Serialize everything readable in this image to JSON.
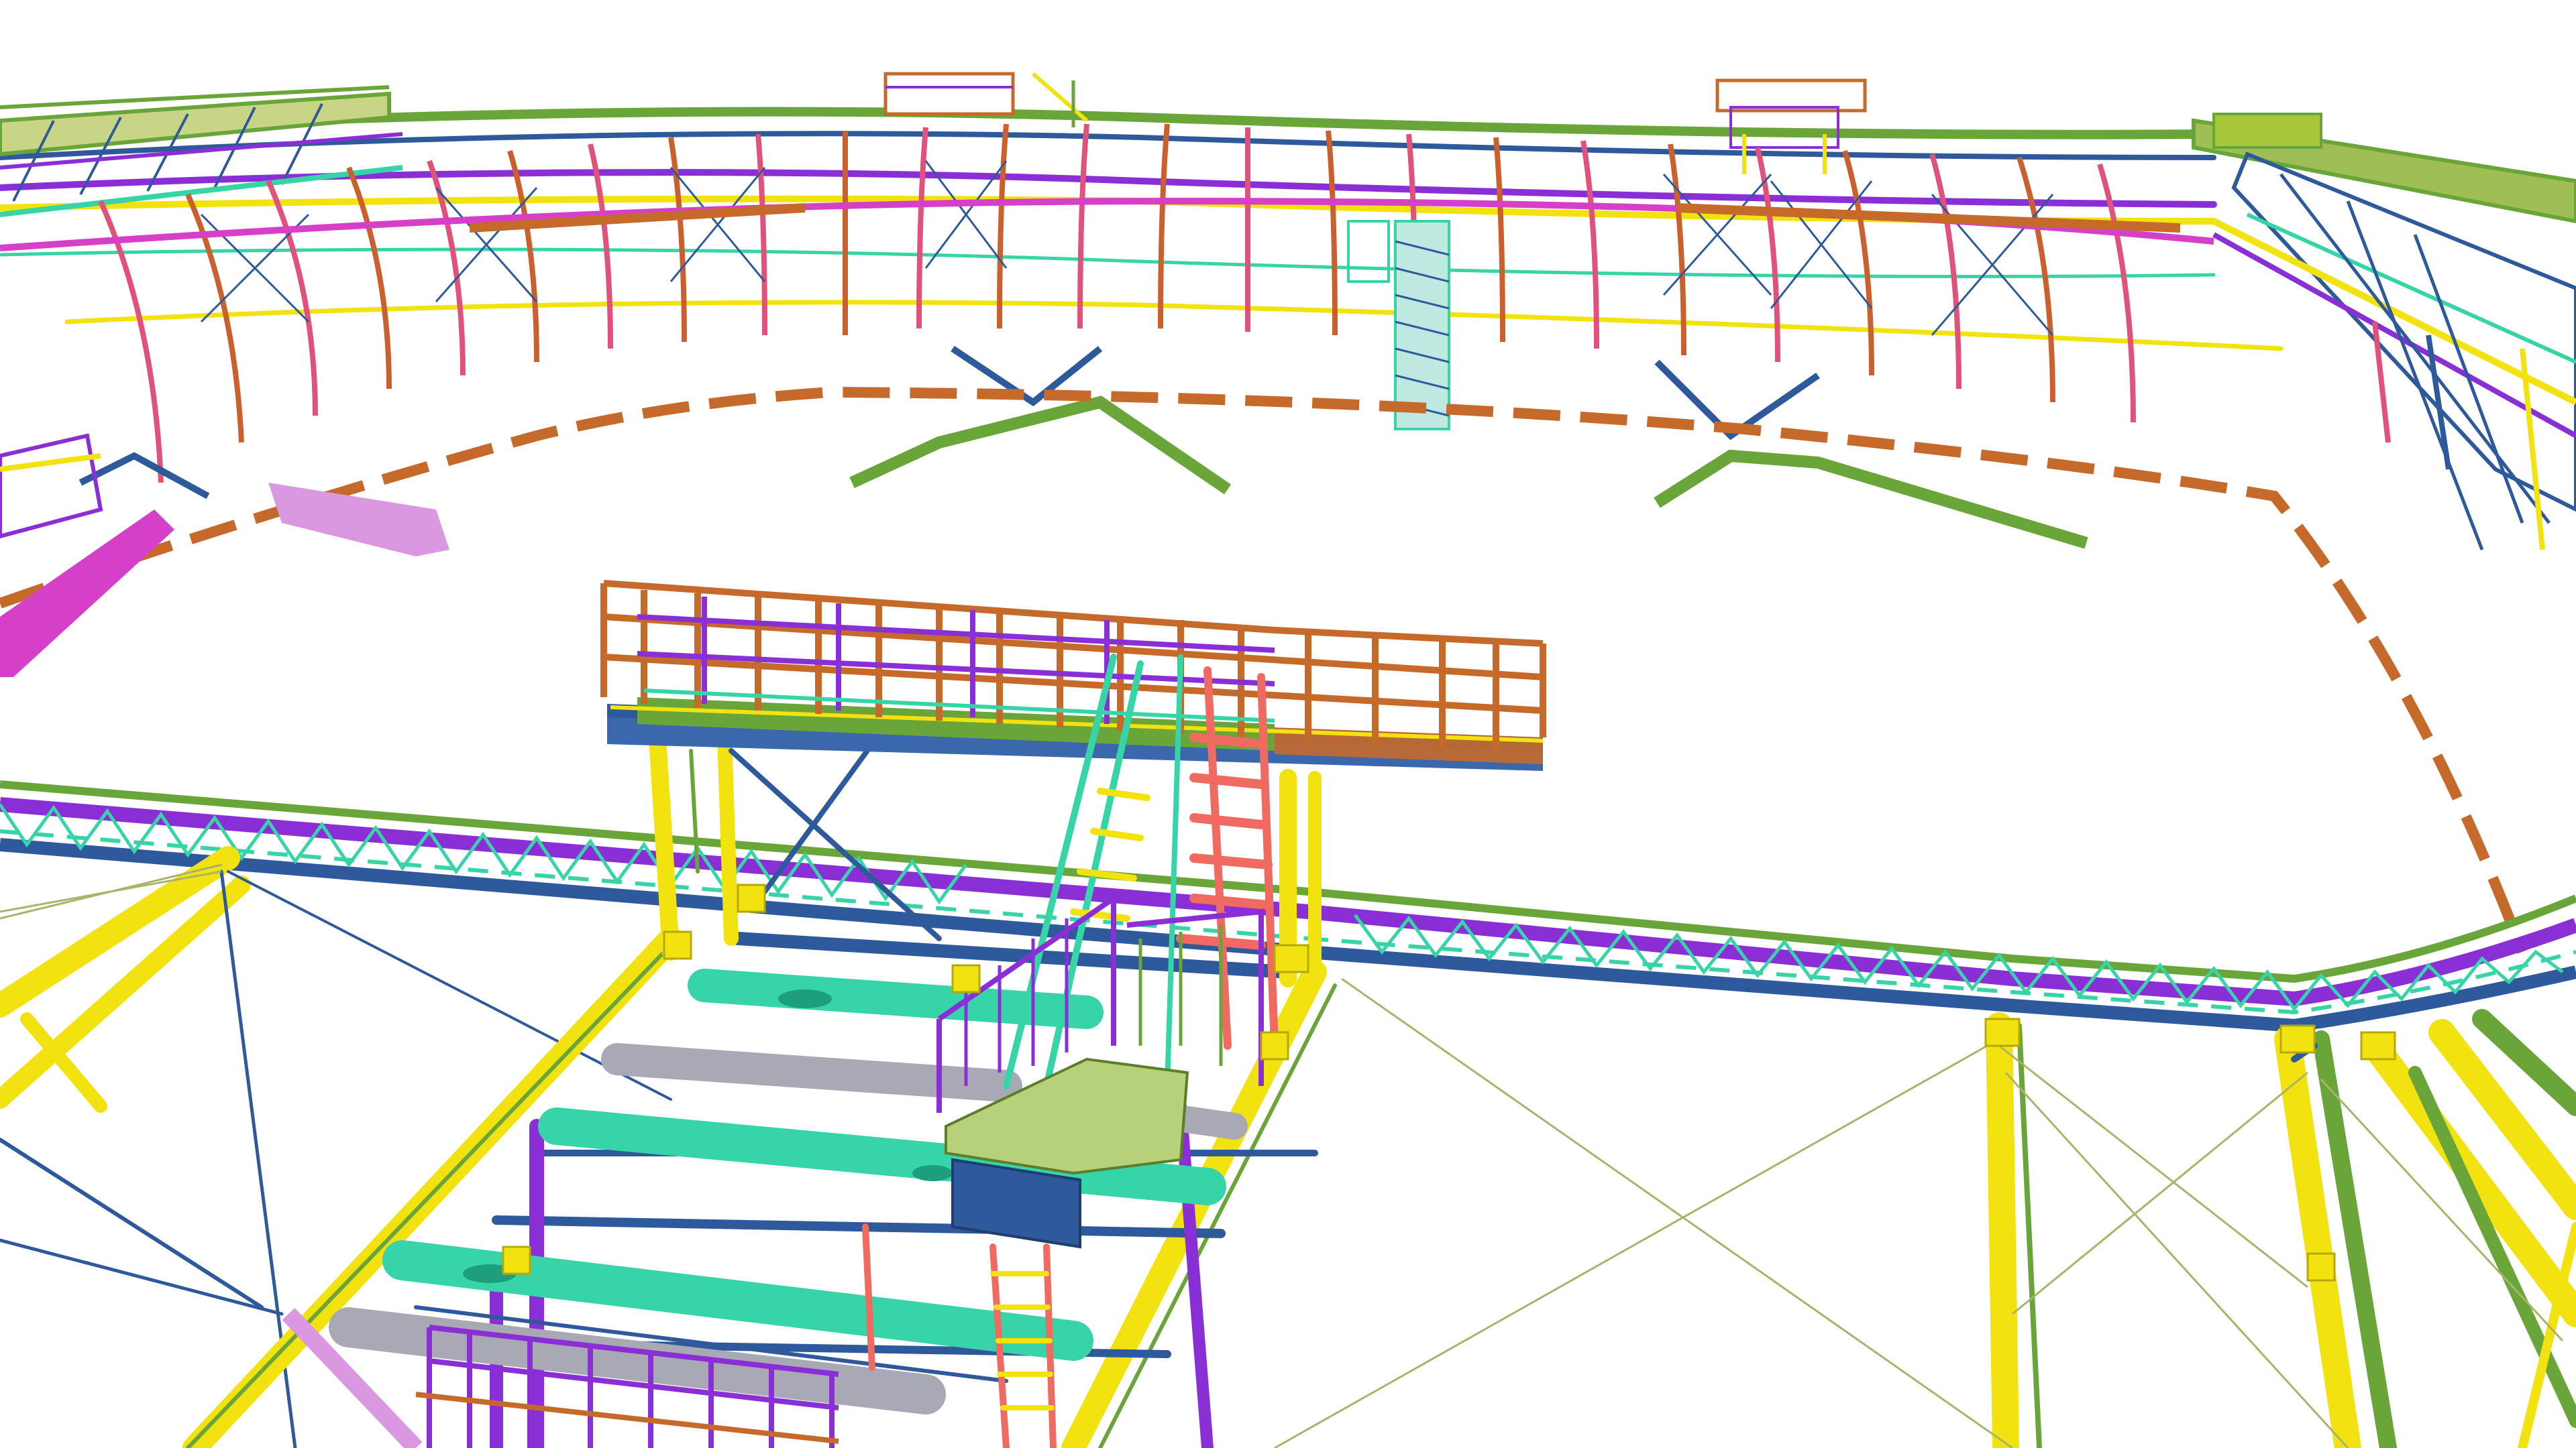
{
  "viewport": {
    "background": "#ffffff",
    "description_hidden": true
  },
  "model": {
    "palette": {
      "truss_yellow": "#f2e20f",
      "brace_blue": "#2e5a9c",
      "chord_purple": "#8a2fd6",
      "arch_orange": "#c9602d",
      "rib_pink": "#e0527a",
      "deck_green": "#6aa53a",
      "pipe_teal": "#37d4a8",
      "pipe_grey": "#a9a9b5",
      "rail_magenta": "#d640c8",
      "stair_coral": "#ef6b61",
      "cable_olive": "#a9b46a",
      "rim_brown": "#c56a2a",
      "bar_lime": "#a8c63a",
      "grating_green": "#b7d07a"
    }
  }
}
